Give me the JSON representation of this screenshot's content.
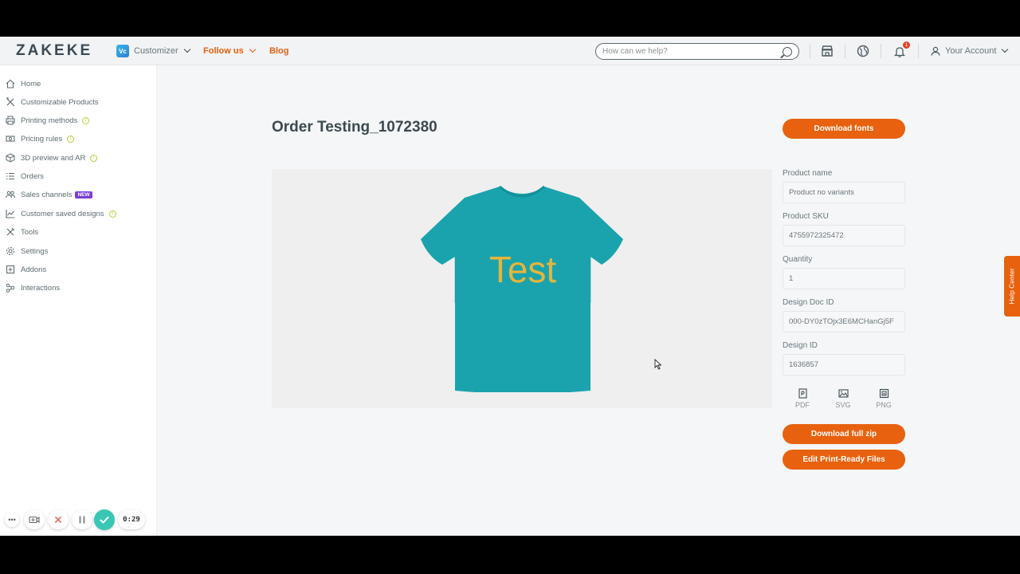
{
  "header": {
    "logo": "ZAKEKE",
    "app_badge": "Vc",
    "app_name": "Customizer",
    "follow_us": "Follow us",
    "blog": "Blog",
    "search_placeholder": "How can we help?",
    "notification_count": "1",
    "account": "Your Account"
  },
  "sidebar": {
    "items": [
      {
        "label": "Home",
        "icon": "home-icon"
      },
      {
        "label": "Customizable Products",
        "icon": "tools-icon"
      },
      {
        "label": "Printing methods",
        "icon": "printer-icon",
        "info": true
      },
      {
        "label": "Pricing rules",
        "icon": "money-icon",
        "info": true
      },
      {
        "label": "3D preview and AR",
        "icon": "cube-icon",
        "info": true
      },
      {
        "label": "Orders",
        "icon": "list-icon"
      },
      {
        "label": "Sales channels",
        "icon": "people-icon",
        "badge": "NEW"
      },
      {
        "label": "Customer saved designs",
        "icon": "chart-icon",
        "info": true
      },
      {
        "label": "Tools",
        "icon": "wrench-icon"
      },
      {
        "label": "Settings",
        "icon": "gear-icon"
      },
      {
        "label": "Addons",
        "icon": "addon-icon"
      },
      {
        "label": "Interactions",
        "icon": "interactions-icon"
      }
    ]
  },
  "main": {
    "title": "Order Testing_1072380",
    "download_fonts": "Download fonts",
    "shirt_text": "Test",
    "colors": {
      "accent": "#e8610e",
      "shirt": "#1aa3ad",
      "shirt_text": "#e6b53a"
    },
    "fields": [
      {
        "label": "Product name",
        "value": "Product no variants"
      },
      {
        "label": "Product SKU",
        "value": "4755972325472"
      },
      {
        "label": "Quantity",
        "value": "1"
      },
      {
        "label": "Design Doc ID",
        "value": "000-DY0zTOjx3E6MCHanGj5F"
      },
      {
        "label": "Design ID",
        "value": "1636857"
      }
    ],
    "formats": [
      "PDF",
      "SVG",
      "PNG"
    ],
    "download_zip": "Download full zip",
    "edit_print": "Edit Print-Ready Files"
  },
  "help_center": "Help Center",
  "recorder": {
    "time": "0:29"
  }
}
